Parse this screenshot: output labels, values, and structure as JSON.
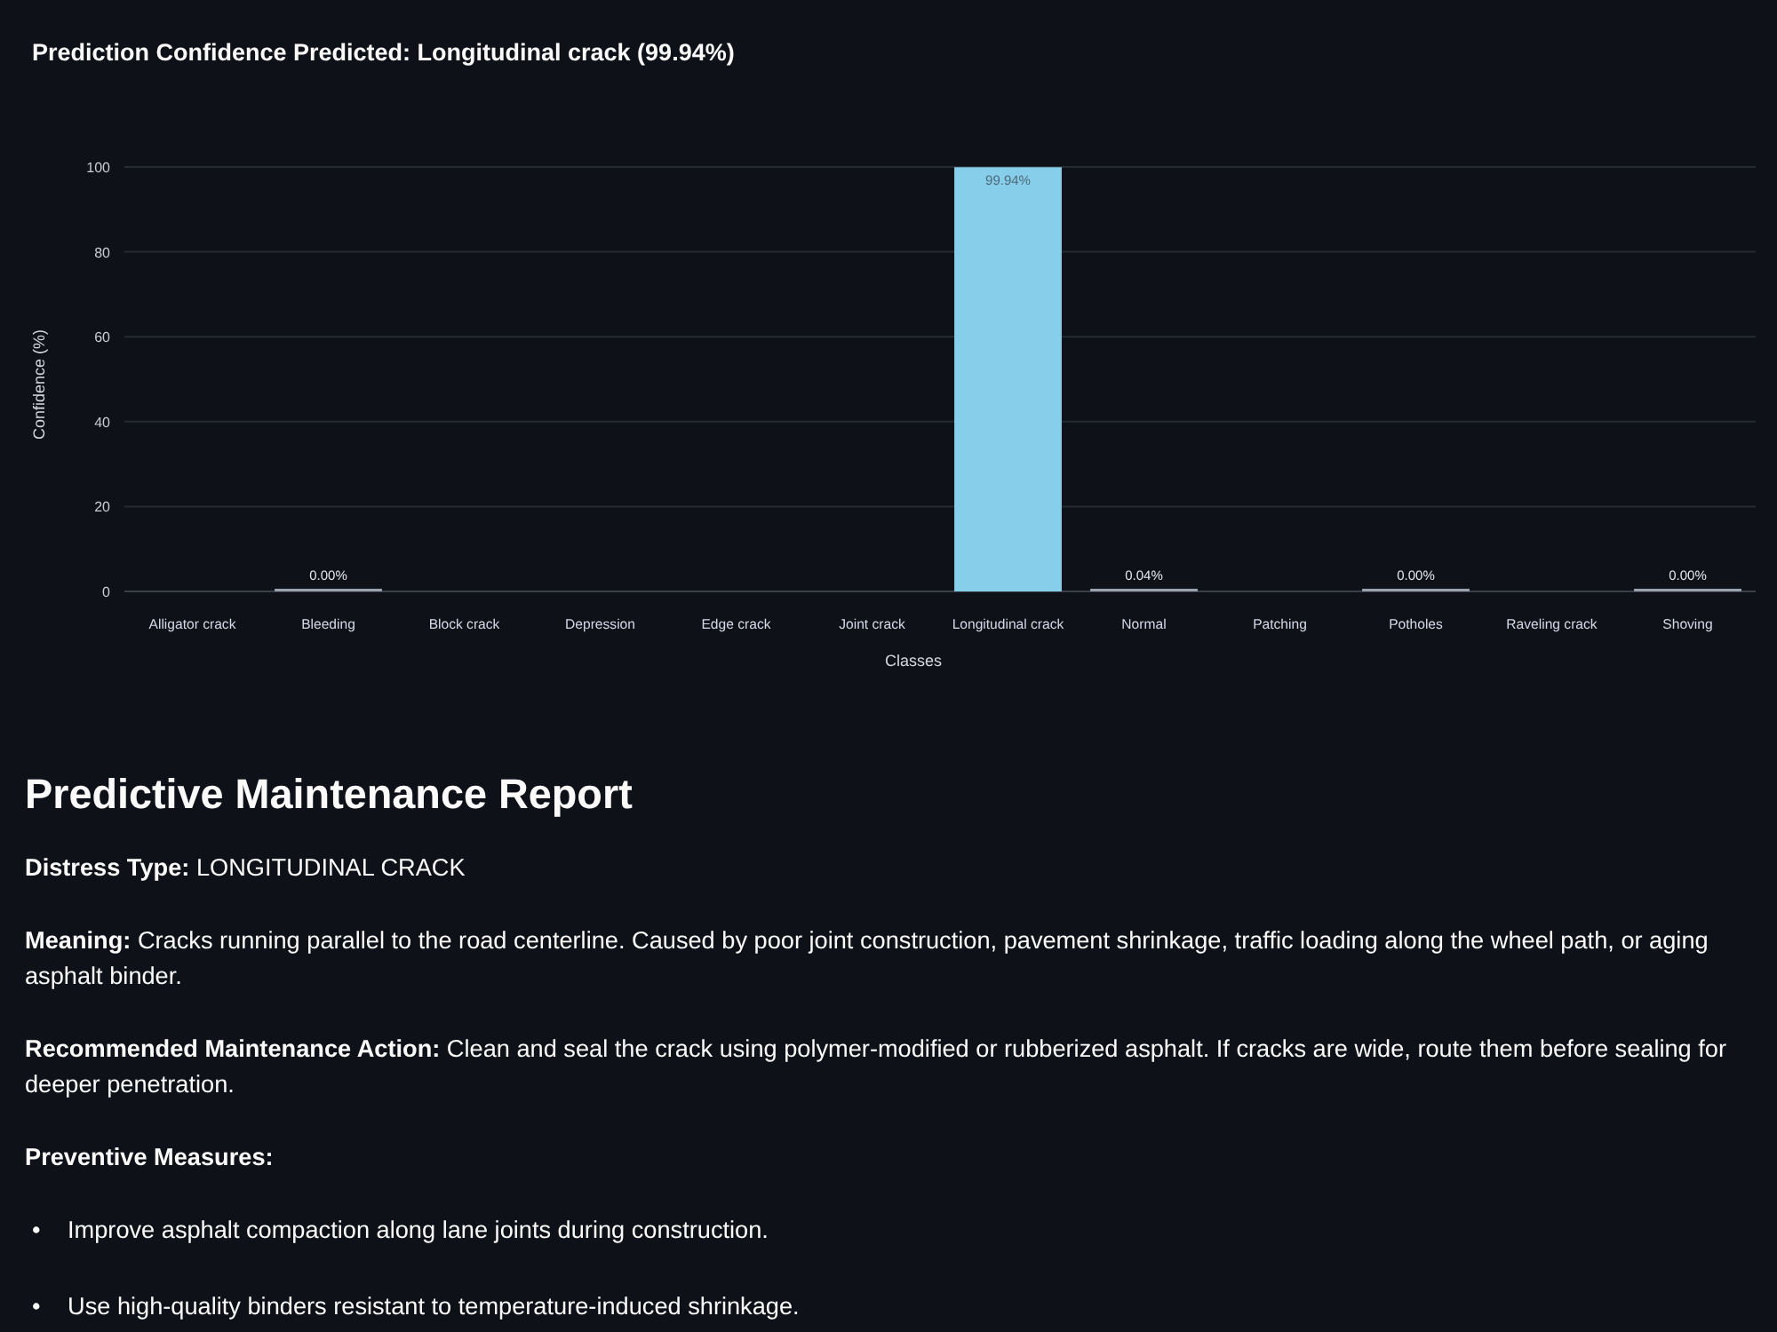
{
  "chart_section": {
    "title": "Prediction Confidence Predicted: Longitudinal crack (99.94%)",
    "chart_data": {
      "type": "bar",
      "xlabel": "Classes",
      "ylabel": "Confidence (%)",
      "categories": [
        "Alligator crack",
        "Bleeding",
        "Block crack",
        "Depression",
        "Edge crack",
        "Joint crack",
        "Longitudinal crack",
        "Normal",
        "Patching",
        "Potholes",
        "Raveling crack",
        "Shoving"
      ],
      "values": [
        null,
        0,
        null,
        null,
        null,
        null,
        99.94,
        0.04,
        null,
        0,
        null,
        0
      ],
      "ylim": [
        0,
        100
      ],
      "yticks": [
        0,
        20,
        40,
        60,
        80,
        100
      ],
      "grid": true,
      "value_labels": [
        null,
        "0.00%",
        null,
        null,
        null,
        null,
        "99.94%",
        "0.04%",
        null,
        "0.00%",
        null,
        "0.00%"
      ]
    }
  },
  "report": {
    "heading": "Predictive Maintenance Report",
    "fields": [
      "**Distress Type:** LONGITUDINAL CRACK",
      "**Meaning:** Cracks running parallel to the road centerline. Caused by poor joint construction, pavement shrinkage, traffic loading along the wheel path, or aging asphalt binder.",
      "**Recommended Maintenance Action:** Clean and seal the crack using polymer-modified or rubberized asphalt. If cracks are wide, route them before sealing for deeper penetration."
    ],
    "preventive_heading": "Preventive Measures:",
    "measures": [
      {
        "marker": "•",
        "text": "Improve asphalt compaction along lane joints during construction."
      },
      {
        "marker": "•",
        "text": "Use high-quality binders resistant to temperature-induced shrinkage."
      }
    ]
  }
}
